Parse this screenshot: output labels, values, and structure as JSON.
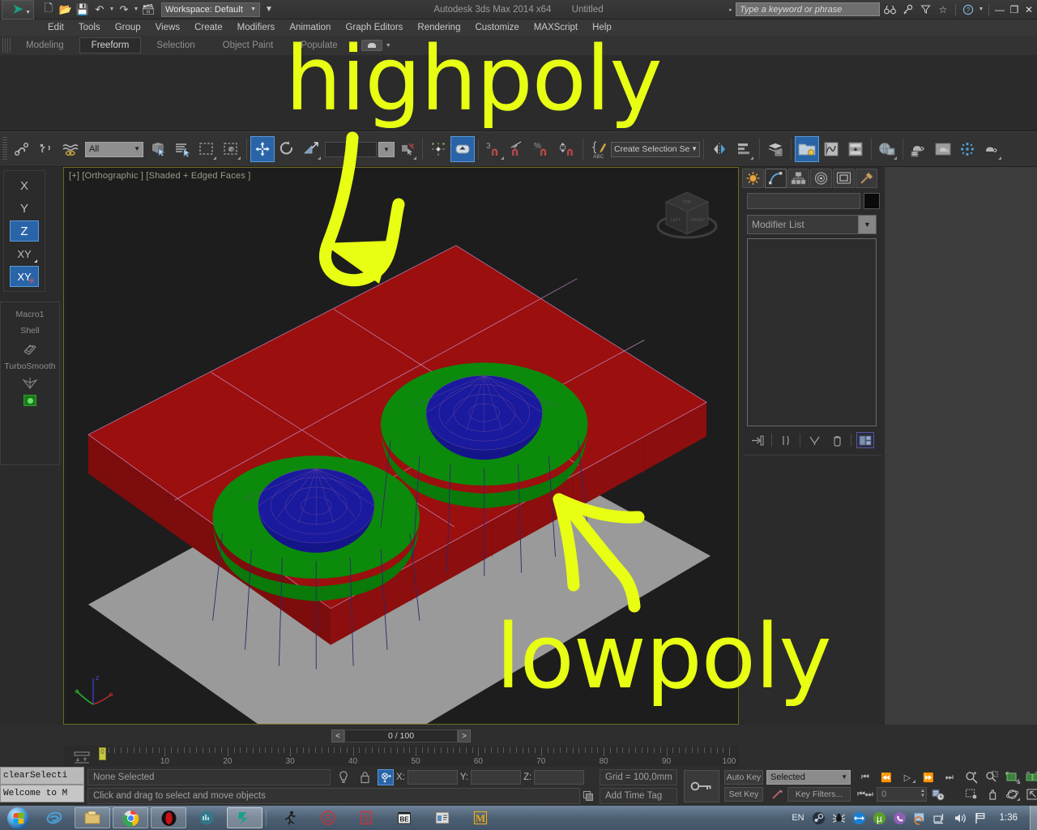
{
  "titlebar": {
    "app_title": "Autodesk 3ds Max  2014 x64",
    "document": "Untitled",
    "workspace": "Workspace: Default",
    "search_placeholder": "Type a keyword or phrase",
    "quick_access": [
      {
        "name": "new-scene-icon",
        "glyph": "⬚"
      },
      {
        "name": "open-file-icon",
        "glyph": "🗁"
      },
      {
        "name": "save-file-icon",
        "glyph": "💾"
      },
      {
        "name": "undo-icon",
        "glyph": "↶"
      },
      {
        "name": "redo-icon",
        "glyph": "↷"
      },
      {
        "name": "project-folder-icon",
        "glyph": "🗂"
      }
    ],
    "right_icons": [
      {
        "name": "binoculars-icon",
        "glyph": "🔭"
      },
      {
        "name": "key-icon",
        "glyph": "🔑"
      },
      {
        "name": "funnel-icon",
        "glyph": "⧓"
      },
      {
        "name": "favorite-star-icon",
        "glyph": "☆"
      },
      {
        "name": "help-icon",
        "glyph": "ⓘ"
      }
    ],
    "window_controls": [
      "—",
      "❐",
      "✕"
    ]
  },
  "menubar": {
    "items": [
      "Edit",
      "Tools",
      "Group",
      "Views",
      "Create",
      "Modifiers",
      "Animation",
      "Graph Editors",
      "Rendering",
      "Customize",
      "MAXScript",
      "Help"
    ]
  },
  "ribbon": {
    "tabs": [
      "Modeling",
      "Freeform",
      "Selection",
      "Object Paint",
      "Populate"
    ],
    "active_tab": "Freeform"
  },
  "main_toolbar": {
    "selection_filter": "All",
    "selection_set_placeholder": "Create Selection Se",
    "snap_percent_label": "%",
    "snap_count_label": "3",
    "buttons": [
      {
        "name": "select-and-link-icon",
        "glyph": "🔗",
        "state": "off"
      },
      {
        "name": "unlink-selection-icon",
        "glyph": "✂",
        "state": "off"
      },
      {
        "name": "bind-to-space-warp-icon",
        "glyph": "≈",
        "state": "off"
      },
      {
        "name": "select-object-icon",
        "glyph": "⬛",
        "state": "off"
      },
      {
        "name": "select-by-name-icon",
        "glyph": "☰",
        "state": "off"
      },
      {
        "name": "rectangular-selection-region-icon",
        "glyph": "⬚",
        "state": "off"
      },
      {
        "name": "window-crossing-icon",
        "glyph": "▣",
        "state": "off"
      },
      {
        "name": "select-and-move-icon",
        "glyph": "✜",
        "state": "on"
      },
      {
        "name": "select-and-rotate-icon",
        "glyph": "↻",
        "state": "off"
      },
      {
        "name": "select-and-scale-icon",
        "glyph": "⤡",
        "state": "off"
      },
      {
        "name": "use-center-flyout-icon",
        "glyph": "⌖",
        "state": "off"
      },
      {
        "name": "select-and-manipulate-icon",
        "glyph": "⬆",
        "state": "on"
      },
      {
        "name": "snaps-toggle-icon",
        "glyph": "⊓",
        "state": "off"
      },
      {
        "name": "angle-snap-toggle-icon",
        "glyph": "∠",
        "state": "off"
      },
      {
        "name": "percent-snap-toggle-icon",
        "glyph": "⊓",
        "state": "off"
      },
      {
        "name": "spinner-snap-toggle-icon",
        "glyph": "⬍",
        "state": "off"
      },
      {
        "name": "edit-named-selection-sets-icon",
        "glyph": "✎",
        "state": "off"
      },
      {
        "name": "mirror-icon",
        "glyph": "◧",
        "state": "off"
      },
      {
        "name": "align-flyout-icon",
        "glyph": "≡",
        "state": "off"
      },
      {
        "name": "layer-manager-icon",
        "glyph": "≣",
        "state": "off"
      },
      {
        "name": "scene-explorer-icon",
        "glyph": "🗂",
        "state": "on"
      },
      {
        "name": "curve-editor-icon",
        "glyph": "∿",
        "state": "off"
      },
      {
        "name": "schematic-view-icon",
        "glyph": "⬓",
        "state": "off"
      },
      {
        "name": "material-editor-icon",
        "glyph": "◉",
        "state": "off"
      },
      {
        "name": "render-setup-icon",
        "glyph": "⛾",
        "state": "off"
      },
      {
        "name": "rendered-frame-window-icon",
        "glyph": "⛾",
        "state": "off"
      },
      {
        "name": "render-production-icon",
        "glyph": "❂",
        "state": "off"
      },
      {
        "name": "render-iterative-icon",
        "glyph": "⛾",
        "state": "off"
      }
    ]
  },
  "left_panel": {
    "axis_constraints": [
      {
        "label": "X",
        "active": false
      },
      {
        "label": "Y",
        "active": false
      },
      {
        "label": "Z",
        "active": true
      },
      {
        "label": "XY",
        "active": false
      },
      {
        "label": "XY",
        "active": true
      }
    ],
    "macro_title": "Macro1",
    "macro_items": [
      {
        "label": "Shell",
        "icon": "shell-modifier-icon"
      },
      {
        "label": "TurboSmooth",
        "icon": "turbosmooth-modifier-icon"
      }
    ]
  },
  "viewport": {
    "label": "[+] [Orthographic ] [Shaded + Edged Faces ]",
    "tripod_axes": [
      "z",
      "x",
      "y"
    ],
    "colors": {
      "lowpoly_plane": "#9a9a9a",
      "highpoly_plane": "#9b0f0f",
      "dome_collar": "#0c8a0c",
      "dome_cap": "#1a1a9e",
      "background": "#1d1d1d",
      "wireframe": "#c58fc5"
    }
  },
  "command_panel": {
    "tabs": [
      {
        "name": "create-tab",
        "glyph": "☀",
        "active": false
      },
      {
        "name": "modify-tab",
        "glyph": "◜",
        "active": true
      },
      {
        "name": "hierarchy-tab",
        "glyph": "⛓",
        "active": false
      },
      {
        "name": "motion-tab",
        "glyph": "◎",
        "active": false
      },
      {
        "name": "display-tab",
        "glyph": "❐",
        "active": false
      },
      {
        "name": "utilities-tab",
        "glyph": "🔨",
        "active": false
      }
    ],
    "object_name": "",
    "modifier_list_label": "Modifier List",
    "stack_tools": [
      {
        "name": "pin-stack-icon",
        "glyph": "⊣"
      },
      {
        "name": "show-end-result-icon",
        "glyph": "‖"
      },
      {
        "name": "make-unique-icon",
        "glyph": "⅄"
      },
      {
        "name": "remove-modifier-icon",
        "glyph": "⎋"
      },
      {
        "name": "configure-modifier-sets-icon",
        "glyph": "⊞"
      }
    ]
  },
  "time_slider": {
    "prev_label": "<",
    "next_label": ">",
    "frame_text": "0 / 100",
    "ruler_labels": [
      "10",
      "20",
      "30",
      "40",
      "50",
      "60",
      "70",
      "80",
      "90",
      "100"
    ],
    "ruler_min": 0,
    "ruler_max": 100,
    "playhead_frame": 0,
    "playhead_label": "0"
  },
  "mini_listener": {
    "line1": "clearSelecti",
    "line2": "Welcome to M"
  },
  "status_bar": {
    "selection_info": "None Selected",
    "prompt": "Click and drag to select and move objects",
    "x_label": "X:",
    "y_label": "Y:",
    "z_label": "Z:",
    "x_value": "",
    "y_value": "",
    "z_value": "",
    "grid_text": "Grid = 100,0mm",
    "time_tag": "Add Time Tag",
    "auto_key": "Auto Key",
    "set_key": "Set Key",
    "key_mode": "Selected",
    "key_filters": "Key Filters...",
    "current_frame": "0",
    "icons": [
      {
        "name": "isolate-selection-icon",
        "glyph": "💡"
      },
      {
        "name": "selection-lock-icon",
        "glyph": "🔒"
      },
      {
        "name": "absolute-relative-transform-icon",
        "glyph": "⨂"
      }
    ],
    "playback_buttons": [
      {
        "name": "go-to-start-icon",
        "glyph": "⏮"
      },
      {
        "name": "previous-frame-icon",
        "glyph": "⏴"
      },
      {
        "name": "play-animation-icon",
        "glyph": "▷"
      },
      {
        "name": "next-frame-icon",
        "glyph": "⏵"
      },
      {
        "name": "go-to-end-icon",
        "glyph": "⏭"
      }
    ],
    "nav_buttons": [
      {
        "name": "zoom-icon",
        "glyph": "🔍"
      },
      {
        "name": "zoom-all-icon",
        "glyph": "⛶"
      },
      {
        "name": "zoom-extents-icon",
        "glyph": "⬜"
      },
      {
        "name": "zoom-extents-all-icon",
        "glyph": "⬛"
      },
      {
        "name": "field-of-view-icon",
        "glyph": "◳"
      },
      {
        "name": "pan-view-icon",
        "glyph": "✋"
      },
      {
        "name": "orbit-icon",
        "glyph": "⥁"
      },
      {
        "name": "maximize-viewport-icon",
        "glyph": "⤡"
      }
    ]
  },
  "taskbar": {
    "apps": [
      {
        "name": "internet-explorer-icon",
        "glyph": "℮",
        "color": "#4aa3dd",
        "state": "plain"
      },
      {
        "name": "windows-explorer-icon",
        "glyph": "🗂",
        "color": "#e8c06a",
        "state": "open"
      },
      {
        "name": "google-chrome-icon",
        "glyph": "◉",
        "color": "#4285f4",
        "state": "open"
      },
      {
        "name": "opera-icon",
        "glyph": "⬬",
        "color": "#cc0f16",
        "state": "open"
      },
      {
        "name": "media-app-icon",
        "glyph": "◑",
        "color": "#2a7f8f",
        "state": "plain"
      },
      {
        "name": "3ds-max-icon",
        "glyph": "➤",
        "color": "#18a08a",
        "state": "active"
      },
      {
        "name": "runner-app-icon",
        "glyph": "🏃",
        "color": "#1f1f1f",
        "state": "plain"
      },
      {
        "name": "substance-icon",
        "glyph": "§",
        "color": "#cc3333",
        "state": "plain"
      },
      {
        "name": "substance-designer-icon",
        "glyph": "§",
        "color": "#cc3333",
        "state": "plain"
      },
      {
        "name": "bodypaint-icon",
        "glyph": "🎬",
        "color": "#e0e0e0",
        "state": "plain"
      },
      {
        "name": "window-app-icon",
        "glyph": "▤",
        "color": "#d8d8d8",
        "state": "plain"
      },
      {
        "name": "marmoset-icon",
        "glyph": "M",
        "color": "#e8a81c",
        "state": "plain"
      }
    ],
    "tray": [
      {
        "name": "steam-icon",
        "glyph": "♨",
        "color": "#c6d4de"
      },
      {
        "name": "antivirus-spider-icon",
        "glyph": "☸",
        "color": "#e8e8e8"
      },
      {
        "name": "teamviewer-icon",
        "glyph": "⟷",
        "color": "#1a7fd4"
      },
      {
        "name": "utorrent-icon",
        "glyph": "µ",
        "color": "#7ac943"
      },
      {
        "name": "viber-icon",
        "glyph": "☎",
        "color": "#8e5fb5"
      },
      {
        "name": "update-icon",
        "glyph": "↻",
        "color": "#d07a3a"
      },
      {
        "name": "network-icon",
        "glyph": "🖧",
        "color": "#d5dde4"
      },
      {
        "name": "volume-icon",
        "glyph": "🔊",
        "color": "#e2e8ee"
      },
      {
        "name": "action-center-flag-icon",
        "glyph": "⚑",
        "color": "#e2e8ee"
      }
    ],
    "language": "EN",
    "clock": "1:36"
  },
  "annotations": {
    "highpoly_label": "highpoly",
    "lowpoly_label": "lowpoly",
    "color": "#e8ff14"
  }
}
